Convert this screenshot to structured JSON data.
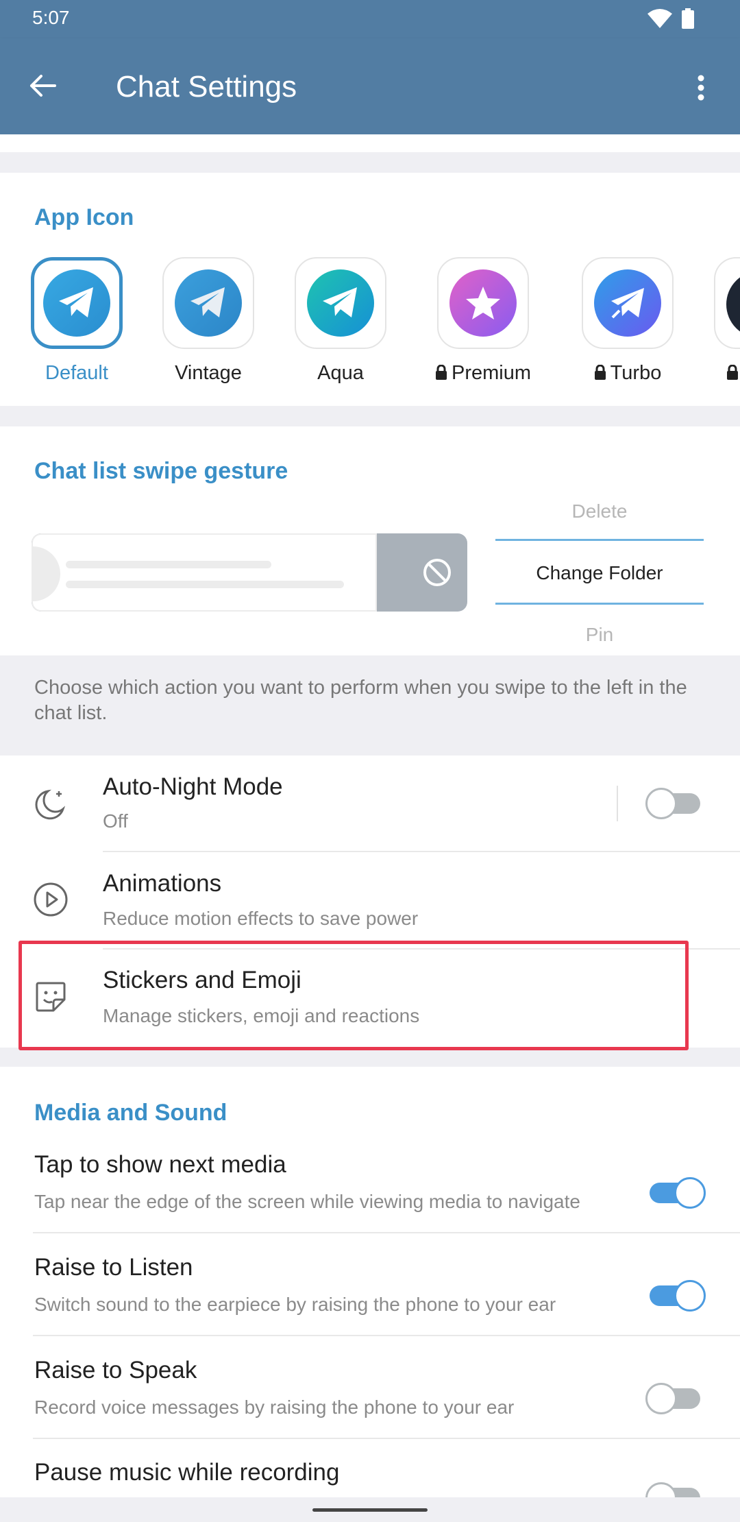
{
  "status": {
    "time": "5:07"
  },
  "appbar": {
    "title": "Chat Settings"
  },
  "app_icon": {
    "header": "App Icon",
    "icons": [
      {
        "label": "Default",
        "locked": false,
        "selected": true
      },
      {
        "label": "Vintage",
        "locked": false,
        "selected": false
      },
      {
        "label": "Aqua",
        "locked": false,
        "selected": false
      },
      {
        "label": "Premium",
        "locked": true,
        "selected": false
      },
      {
        "label": "Turbo",
        "locked": true,
        "selected": false
      }
    ]
  },
  "swipe": {
    "header": "Chat list swipe gesture",
    "options": [
      "Delete",
      "Change Folder",
      "Pin"
    ],
    "selected": "Change Folder",
    "info": "Choose which action you want to perform when you swipe to the left in the chat list."
  },
  "rows": [
    {
      "title": "Auto-Night Mode",
      "subtitle": "Off",
      "icon": "moon-icon"
    },
    {
      "title": "Animations",
      "subtitle": "Reduce motion effects to save power",
      "icon": "play-icon"
    },
    {
      "title": "Stickers and Emoji",
      "subtitle": "Manage stickers, emoji and reactions",
      "icon": "sticker-icon"
    }
  ],
  "media": {
    "header": "Media and Sound",
    "items": [
      {
        "title": "Tap to show next media",
        "subtitle": "Tap near the edge of the screen while viewing media to navigate",
        "on": true
      },
      {
        "title": "Raise to Listen",
        "subtitle": "Switch sound to the earpiece by raising the phone to your ear",
        "on": true
      },
      {
        "title": "Raise to Speak",
        "subtitle": "Record voice messages by raising the phone to your ear",
        "on": false
      },
      {
        "title": "Pause music while recording",
        "subtitle": "",
        "on": false
      }
    ]
  },
  "colors": {
    "appbar": "#527da3",
    "accent": "#3a8fc7",
    "highlight": "#e8384f"
  }
}
